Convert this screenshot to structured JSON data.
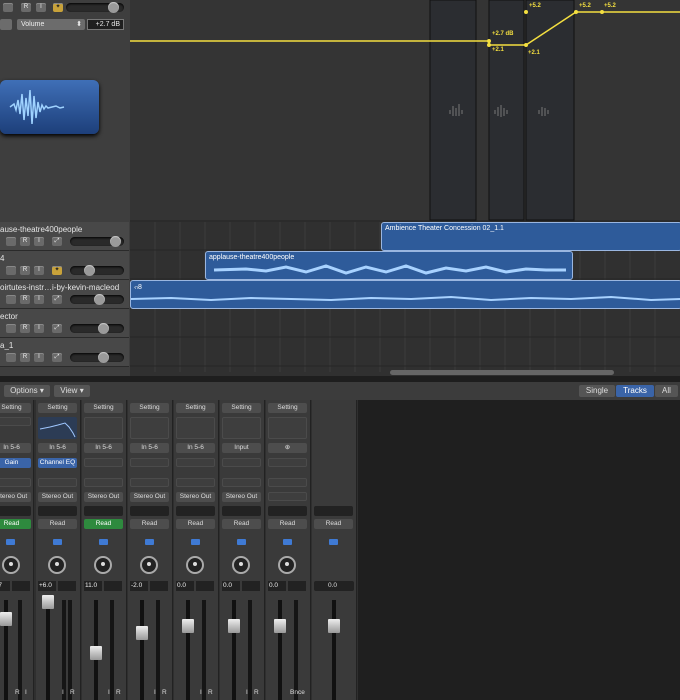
{
  "tracks": {
    "top": {
      "rbtn": "R",
      "ibtn": "I",
      "param": "Volume",
      "param_value": "+2.7 dB"
    },
    "rows": [
      {
        "name": "ause-theatre400people",
        "r": "R",
        "i": "I"
      },
      {
        "name": "4",
        "r": "R",
        "i": "I"
      },
      {
        "name": "oirtutes-instr…i-by-kevin-macleod",
        "r": "R",
        "i": "I"
      },
      {
        "name": "ector",
        "r": "R",
        "i": "I"
      },
      {
        "name": "a_1",
        "r": "R",
        "i": "I"
      }
    ]
  },
  "arrangement": {
    "regions": [
      "Ambience Theater Concession 02_1.1",
      "applause-theatre400people",
      "ၵ8"
    ],
    "automation_labels": [
      "+5.2",
      "+5.2",
      "+5.2",
      "+2.7 dB",
      "+2.1",
      "+2.1"
    ],
    "automation_value_db": 2.7
  },
  "mixer_bar": {
    "options": "Options",
    "view": "View",
    "single": "Single",
    "tracks": "Tracks",
    "all": "All"
  },
  "strips": [
    {
      "setting": "Setting",
      "input": "In 5-6",
      "plugin": "Gain",
      "output": "Stereo Out",
      "auto": "Read",
      "gain": "2.7",
      "bottom": "R",
      "bottom2": "I"
    },
    {
      "setting": "Setting",
      "input": "In 5-6",
      "plugin": "Channel EQ",
      "output": "Stereo Out",
      "auto": "Read",
      "gain": "+6.0",
      "bottom": "I",
      "bottom2": "R"
    },
    {
      "setting": "Setting",
      "input": "In 5-6",
      "plugin": "",
      "output": "Stereo Out",
      "auto": "Read",
      "gain": "11.0",
      "bottom": "I",
      "bottom2": "R"
    },
    {
      "setting": "Setting",
      "input": "In 5-6",
      "plugin": "",
      "output": "Stereo Out",
      "auto": "Read",
      "gain": "-2.0",
      "bottom": "I",
      "bottom2": "R"
    },
    {
      "setting": "Setting",
      "input": "In 5-6",
      "plugin": "",
      "output": "Stereo Out",
      "auto": "Read",
      "gain": "0.0",
      "bottom": "I",
      "bottom2": "R"
    },
    {
      "setting": "Setting",
      "input": "Input",
      "plugin": "",
      "output": "Stereo Out",
      "auto": "Read",
      "gain": "0.0",
      "bottom": "I",
      "bottom2": "R"
    },
    {
      "setting": "Setting",
      "input": "",
      "plugin": "",
      "output": "",
      "auto": "Read",
      "gain": "0.0",
      "bottom": "Bnce",
      "bottom2": ""
    },
    {
      "setting": "",
      "input": "",
      "plugin": "",
      "output": "",
      "auto": "Read",
      "gain": "0.0",
      "bottom": "",
      "bottom2": ""
    }
  ],
  "colors": {
    "region": "#2e5b9a",
    "automation": "#f4df40",
    "read_green": "#2e8a3e",
    "accent_blue": "#3a64a8"
  }
}
